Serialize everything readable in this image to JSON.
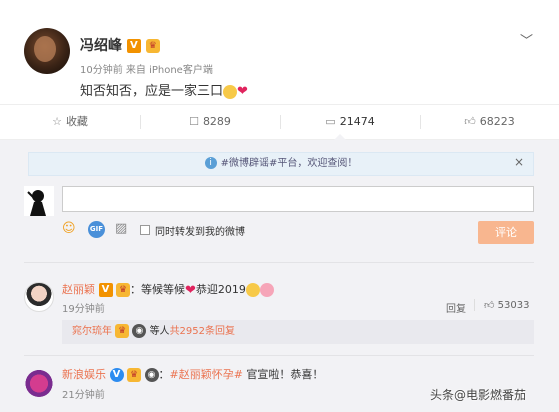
{
  "post": {
    "author": "冯绍峰",
    "meta": "10分钟前 来自 iPhone客户端",
    "text": "知否知否，应是一家三口"
  },
  "actions": {
    "favorite": "收藏",
    "forward_count": "8289",
    "comment_count": "21474",
    "like_count": "68223"
  },
  "notice": {
    "text": "#微博辟谣#平台，欢迎查阅！"
  },
  "composer": {
    "input_value": "",
    "sync_label": "同时转发到我的微博",
    "submit_label": "评论"
  },
  "comments": [
    {
      "name": "赵丽颖",
      "text": "：等候等候",
      "text_after": "恭迎2019",
      "time": "19分钟前",
      "reply_label": "回复",
      "likes": "53033",
      "sub": {
        "name": "窕尔琉年",
        "mid": "等人",
        "more": "共2952条回复"
      }
    },
    {
      "name": "新浪娱乐",
      "tag": "#赵丽颖怀孕#",
      "text": " 官宣啦！恭喜！",
      "time": "21分钟前"
    }
  ],
  "watermark": "头条@电影燃番茄",
  "colors": {
    "orange_accent": "#eb7350",
    "submit_bg": "#f8b68f",
    "panel_bg": "#f2f2f5"
  }
}
